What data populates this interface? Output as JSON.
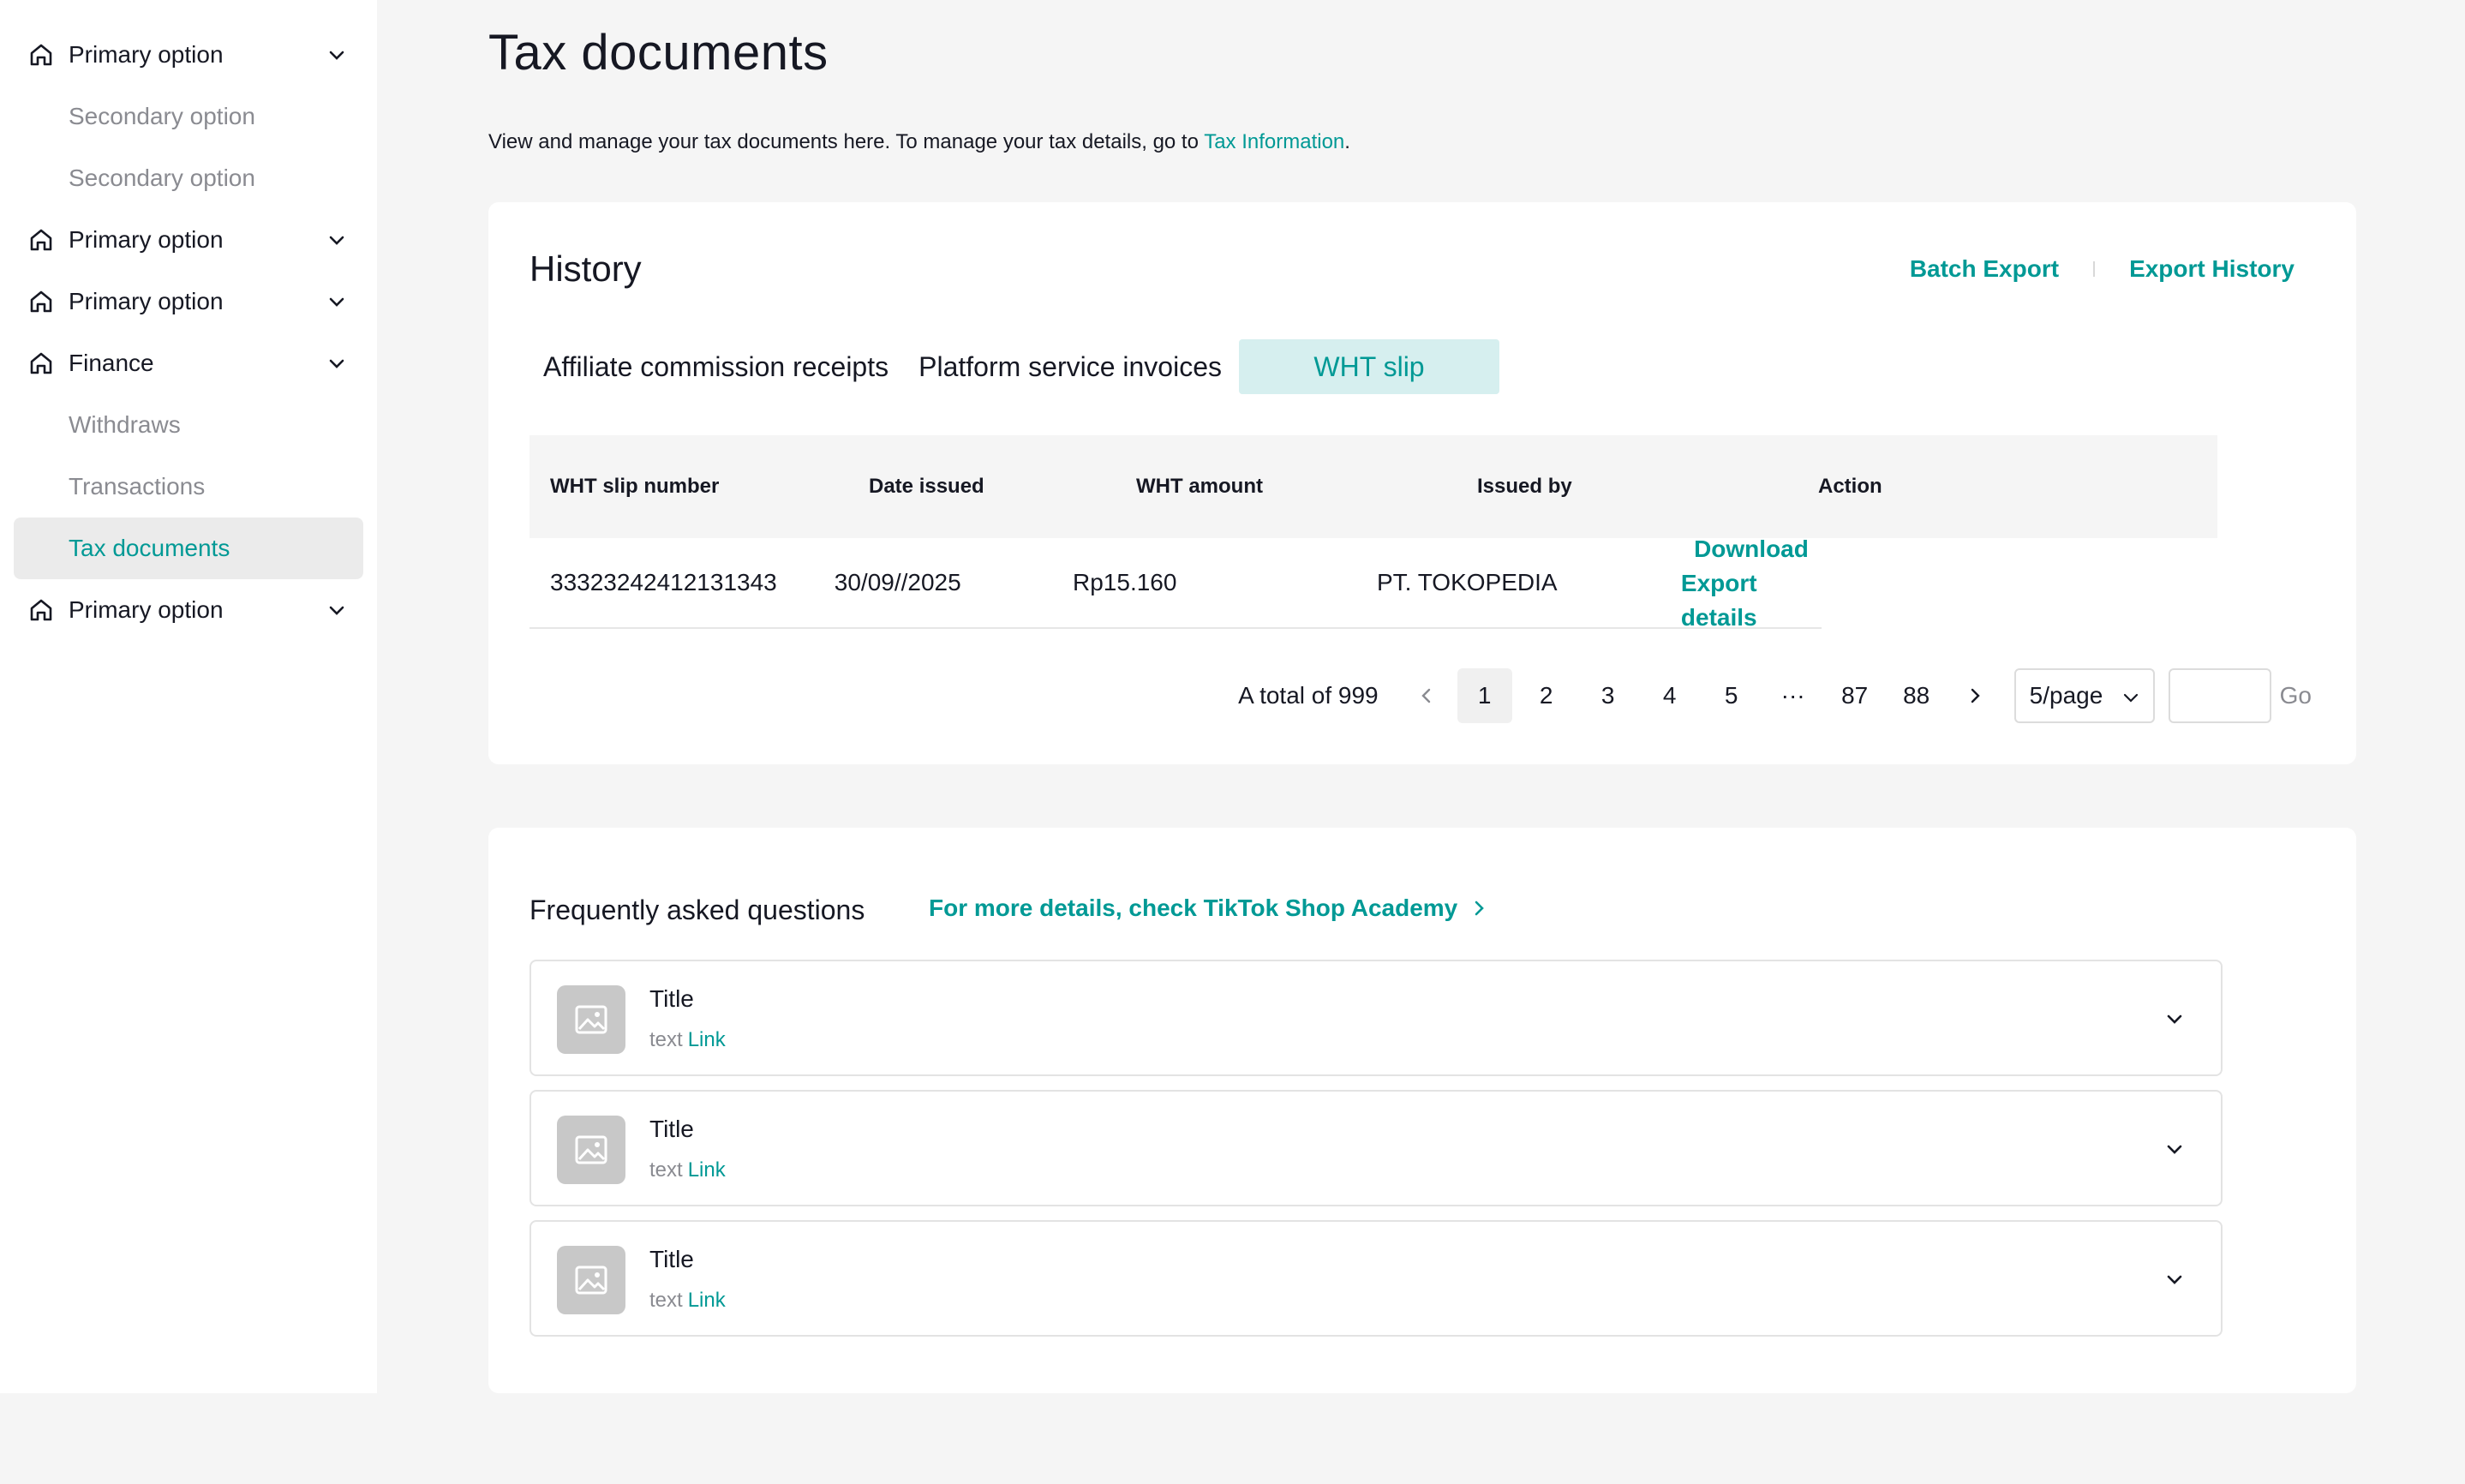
{
  "sidebar": {
    "items": [
      {
        "label": "Primary option",
        "type": "primary"
      },
      {
        "label": "Secondary option",
        "type": "secondary"
      },
      {
        "label": "Secondary option",
        "type": "secondary"
      },
      {
        "label": "Primary option",
        "type": "primary"
      },
      {
        "label": "Primary option",
        "type": "primary"
      },
      {
        "label": "Finance",
        "type": "primary"
      },
      {
        "label": "Withdraws",
        "type": "secondary"
      },
      {
        "label": "Transactions",
        "type": "secondary"
      },
      {
        "label": "Tax documents",
        "type": "secondary",
        "active": true
      },
      {
        "label": "Primary option",
        "type": "primary"
      }
    ]
  },
  "page": {
    "title": "Tax documents",
    "description": "View and manage your tax documents here. To manage your tax details, go to ",
    "description_link": "Tax Information",
    "description_end": "."
  },
  "history": {
    "title": "History",
    "batch_export": "Batch Export",
    "export_history": "Export History",
    "tabs": [
      {
        "label": "Affiliate commission receipts"
      },
      {
        "label": "Platform service invoices"
      },
      {
        "label": "WHT slip",
        "active": true
      }
    ],
    "columns": [
      "WHT slip number",
      "Date issued",
      "WHT amount",
      "Issued by",
      "Action"
    ],
    "rows": [
      {
        "slip_number": "33323242412131343",
        "date_issued": "30/09//2025",
        "amount": "Rp15.160",
        "issued_by": "PT. TOKOPEDIA",
        "action_download": "Download",
        "action_export": "Export details"
      }
    ],
    "pagination": {
      "total": "A total of 999",
      "pages": [
        "1",
        "2",
        "3",
        "4",
        "5",
        "···",
        "87",
        "88"
      ],
      "current": "1",
      "per_page": "5/page",
      "go": "Go"
    }
  },
  "faq": {
    "title": "Frequently asked questions",
    "more": "For more details, check TikTok Shop Academy",
    "items": [
      {
        "title": "Title",
        "text": "text",
        "link": "Link"
      },
      {
        "title": "Title",
        "text": "text",
        "link": "Link"
      },
      {
        "title": "Title",
        "text": "text",
        "link": "Link"
      }
    ]
  },
  "colors": {
    "accent": "#009995",
    "accent_bg": "#d6efef",
    "page_bg": "#f5f5f5"
  }
}
